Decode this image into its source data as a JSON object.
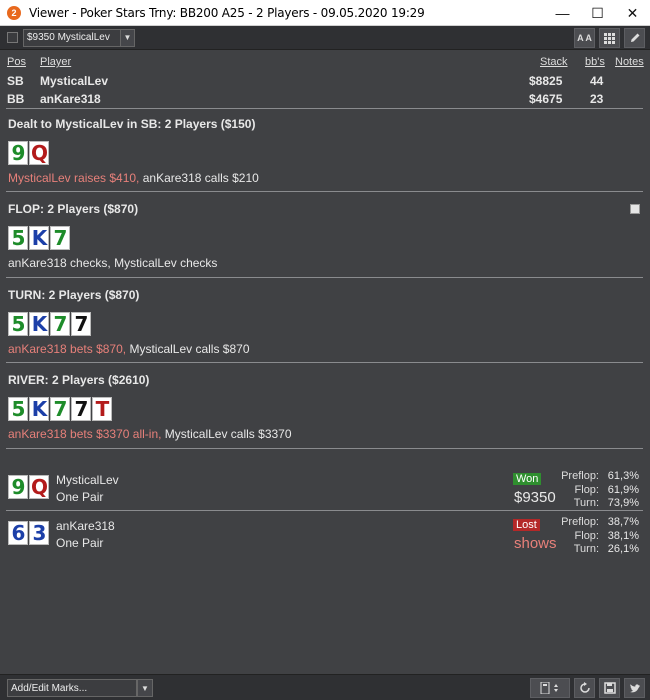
{
  "window": {
    "title": "Viewer - Poker Stars Trny: BB200 A25 - 2 Players - 09.05.2020 19:29",
    "app_icon": "2",
    "controls": [
      "—",
      "☐",
      "✕"
    ]
  },
  "toolbar": {
    "selected_hand": "$9350 MysticalLev",
    "buttons": [
      "A A",
      "grid-icon",
      "pencil-icon"
    ]
  },
  "players": {
    "headers": {
      "pos": "Pos",
      "player": "Player",
      "stack": "Stack",
      "bbs": "bb's",
      "notes": "Notes"
    },
    "rows": [
      {
        "pos": "SB",
        "player": "MysticalLev",
        "stack": "$8825",
        "bbs": "44"
      },
      {
        "pos": "BB",
        "player": "anKare318",
        "stack": "$4675",
        "bbs": "23"
      }
    ]
  },
  "streets": [
    {
      "title": "Dealt to MysticalLev in SB: 2 Players ($150)",
      "cards": [
        {
          "r": "9",
          "c": "green"
        },
        {
          "r": "Q",
          "c": "red"
        }
      ],
      "action_red": "MysticalLev raises $410,",
      "action_white": " anKare318 calls $210"
    },
    {
      "title": "FLOP: 2 Players ($870)",
      "cards": [
        {
          "r": "5",
          "c": "green"
        },
        {
          "r": "K",
          "c": "blue"
        },
        {
          "r": "7",
          "c": "green"
        }
      ],
      "action_red": "",
      "action_white": "anKare318 checks, MysticalLev checks"
    },
    {
      "title": "TURN: 2 Players ($870)",
      "cards": [
        {
          "r": "5",
          "c": "green"
        },
        {
          "r": "K",
          "c": "blue"
        },
        {
          "r": "7",
          "c": "green"
        },
        {
          "r": "7",
          "c": "black"
        }
      ],
      "action_red": "anKare318 bets $870,",
      "action_white": " MysticalLev calls $870"
    },
    {
      "title": "RIVER: 2 Players ($2610)",
      "cards": [
        {
          "r": "5",
          "c": "green"
        },
        {
          "r": "K",
          "c": "blue"
        },
        {
          "r": "7",
          "c": "green"
        },
        {
          "r": "7",
          "c": "black"
        },
        {
          "r": "T",
          "c": "red"
        }
      ],
      "action_red": "anKare318 bets $3370 all-in,",
      "action_white": " MysticalLev calls $3370"
    }
  ],
  "results": [
    {
      "cards": [
        {
          "r": "9",
          "c": "green"
        },
        {
          "r": "Q",
          "c": "red"
        }
      ],
      "name": "MysticalLev",
      "hand": "One Pair",
      "badge": "Won",
      "amount": "$9350",
      "equity": [
        {
          "label": "Preflop:",
          "val": "61,3%"
        },
        {
          "label": "Flop:",
          "val": "61,9%"
        },
        {
          "label": "Turn:",
          "val": "73,9%"
        }
      ]
    },
    {
      "cards": [
        {
          "r": "6",
          "c": "blue"
        },
        {
          "r": "3",
          "c": "blue"
        }
      ],
      "name": "anKare318",
      "hand": "One Pair",
      "badge": "Lost",
      "amount": "shows",
      "equity": [
        {
          "label": "Preflop:",
          "val": "38,7%"
        },
        {
          "label": "Flop:",
          "val": "38,1%"
        },
        {
          "label": "Turn:",
          "val": "26,1%"
        }
      ]
    }
  ],
  "bottombar": {
    "marks_placeholder": "Add/Edit Marks..."
  }
}
